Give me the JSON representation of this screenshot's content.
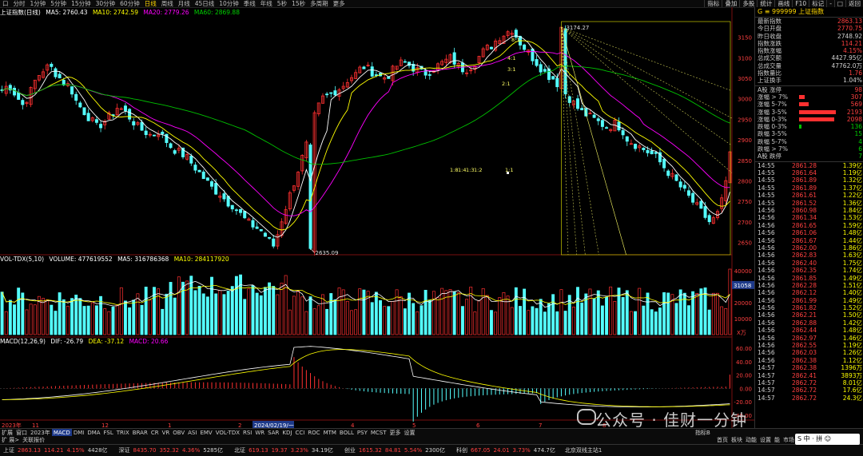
{
  "top_bar": {
    "left_items": [
      "口",
      "分时",
      "1分钟",
      "5分钟",
      "15分钟",
      "30分钟",
      "60分钟",
      "日线",
      "周线",
      "月线",
      "45日线",
      "10分钟",
      "季线",
      "年线",
      "5秒",
      "15秒",
      "多周期",
      "更多"
    ],
    "active": "日线",
    "right_items": [
      "指标",
      "叠加",
      "多股",
      "统计",
      "画线",
      "F10",
      "标记",
      "-",
      "□",
      "返回"
    ]
  },
  "price_legend": {
    "symbol": "上证指数(日线)",
    "ma5": "MA5: 2760.43",
    "ma10": "MA10: 2742.59",
    "ma20": "MA20: 2779.26",
    "ma60": "MA60: 2869.88"
  },
  "volume_legend": {
    "name": "VOL-TDX(5,10)",
    "volume": "VOLUME: 477619552",
    "ma5": "MA5: 316786368",
    "ma10": "MA10: 284117920"
  },
  "macd_legend": {
    "name": "MACD(12,26,9)",
    "dif": "DIF: -26.79",
    "dea": "DEA: -37.12",
    "macd": "MACD: 20.66"
  },
  "annotations": {
    "high": "3174.27",
    "low": "2635.09",
    "fan_labels": [
      "8:1",
      "4:1",
      "3:1",
      "2:1",
      "1:8",
      "1:4",
      "1:3",
      "1:2",
      "1:1"
    ],
    "date_cursor": "2024/02/19/一",
    "vol_value_box": "31058",
    "vol_unit": "X万"
  },
  "price_axis": [
    "3150",
    "3100",
    "3050",
    "3000",
    "2950",
    "2900",
    "2850",
    "2800",
    "2750",
    "2700",
    "2650"
  ],
  "volume_axis": [
    "40000",
    "30000",
    "20000",
    "10000"
  ],
  "macd_axis": [
    "60.00",
    "40.00",
    "20.00",
    "0.00",
    "-20.00",
    "-40.00"
  ],
  "x_labels": [
    "2023年",
    "11",
    "12",
    "1",
    "2",
    "3",
    "4",
    "5",
    "6",
    "7",
    "8"
  ],
  "side_panel": {
    "header": "G ≡ 999999 上证指数",
    "stats": [
      {
        "label": "最新指数",
        "value": "2863.13",
        "color": "#ff4040"
      },
      {
        "label": "今日开盘",
        "value": "2770.75",
        "color": "#ff4040"
      },
      {
        "label": "昨日收盘",
        "value": "2748.92",
        "color": "#d0d0d0"
      },
      {
        "label": "指数涨跌",
        "value": "114.21",
        "color": "#ff4040"
      },
      {
        "label": "指数涨幅",
        "value": "4.15%",
        "color": "#ff4040"
      },
      {
        "label": "总成交额",
        "value": "4427.95亿",
        "color": "#d0d0d0"
      },
      {
        "label": "总成交量",
        "value": "47762.0万",
        "color": "#d0d0d0"
      },
      {
        "label": "指数量比",
        "value": "1.76",
        "color": "#ff4040"
      },
      {
        "label": "上证换手",
        "value": "1.04%",
        "color": "#d0d0d0"
      }
    ],
    "breadth": [
      {
        "label": "A股 涨停",
        "value": "98",
        "color": "#ff4040",
        "bar": 0,
        "kind": "up"
      },
      {
        "label": "涨幅 > 7%",
        "value": "307",
        "color": "#ff4040",
        "bar": 7,
        "kind": "up"
      },
      {
        "label": "涨幅 5-7%",
        "value": "569",
        "color": "#ff4040",
        "bar": 12,
        "kind": "up"
      },
      {
        "label": "涨幅 3-5%",
        "value": "2193",
        "color": "#ff4040",
        "bar": 46,
        "kind": "up"
      },
      {
        "label": "涨幅 0-3%",
        "value": "2098",
        "color": "#ff4040",
        "bar": 44,
        "kind": "up"
      },
      {
        "label": "跌幅 0-3%",
        "value": "136",
        "color": "#00d000",
        "bar": 3,
        "kind": "down"
      },
      {
        "label": "跌幅 3-5%",
        "value": "15",
        "color": "#00d000",
        "bar": 0,
        "kind": "down"
      },
      {
        "label": "跌幅 5-7%",
        "value": "4",
        "color": "#00d000",
        "bar": 0,
        "kind": "down"
      },
      {
        "label": "跌幅 > 7%",
        "value": "6",
        "color": "#00d000",
        "bar": 0,
        "kind": "down"
      },
      {
        "label": "A股 跌停",
        "value": "7",
        "color": "#00d000",
        "bar": 0,
        "kind": "down"
      }
    ],
    "ticks": [
      {
        "time": "14:55",
        "price": "2861.28",
        "amount": "1.39亿"
      },
      {
        "time": "14:55",
        "price": "2861.64",
        "amount": "1.19亿"
      },
      {
        "time": "14:55",
        "price": "2861.89",
        "amount": "1.32亿"
      },
      {
        "time": "14:55",
        "price": "2861.89",
        "amount": "1.37亿"
      },
      {
        "time": "14:55",
        "price": "2861.61",
        "amount": "1.22亿"
      },
      {
        "time": "14:55",
        "price": "2861.52",
        "amount": "1.36亿"
      },
      {
        "time": "14:56",
        "price": "2860.98",
        "amount": "1.84亿"
      },
      {
        "time": "14:56",
        "price": "2861.34",
        "amount": "1.53亿"
      },
      {
        "time": "14:56",
        "price": "2861.65",
        "amount": "1.59亿"
      },
      {
        "time": "14:56",
        "price": "2861.06",
        "amount": "1.48亿"
      },
      {
        "time": "14:56",
        "price": "2861.67",
        "amount": "1.44亿"
      },
      {
        "time": "14:56",
        "price": "2862.00",
        "amount": "1.86亿"
      },
      {
        "time": "14:56",
        "price": "2862.83",
        "amount": "1.63亿"
      },
      {
        "time": "14:56",
        "price": "2862.40",
        "amount": "1.75亿"
      },
      {
        "time": "14:56",
        "price": "2862.35",
        "amount": "1.74亿"
      },
      {
        "time": "14:56",
        "price": "2861.85",
        "amount": "1.49亿"
      },
      {
        "time": "14:56",
        "price": "2862.28",
        "amount": "1.51亿"
      },
      {
        "time": "14:56",
        "price": "2862.12",
        "amount": "1.40亿"
      },
      {
        "time": "14:56",
        "price": "2861.99",
        "amount": "1.49亿"
      },
      {
        "time": "14:56",
        "price": "2861.82",
        "amount": "1.52亿"
      },
      {
        "time": "14:56",
        "price": "2862.21",
        "amount": "1.50亿"
      },
      {
        "time": "14:56",
        "price": "2862.88",
        "amount": "1.42亿"
      },
      {
        "time": "14:56",
        "price": "2862.44",
        "amount": "1.48亿"
      },
      {
        "time": "14:56",
        "price": "2862.97",
        "amount": "1.46亿"
      },
      {
        "time": "14:56",
        "price": "2862.55",
        "amount": "1.19亿"
      },
      {
        "time": "14:56",
        "price": "2862.03",
        "amount": "1.26亿"
      },
      {
        "time": "14:56",
        "price": "2862.38",
        "amount": "1.12亿"
      },
      {
        "time": "14:57",
        "price": "2862.38",
        "amount": "1396万"
      },
      {
        "time": "14:57",
        "price": "2862.41",
        "amount": "3893万"
      },
      {
        "time": "14:57",
        "price": "2862.72",
        "amount": "8.01亿"
      },
      {
        "time": "14:57",
        "price": "2862.72",
        "amount": "17.6亿"
      },
      {
        "time": "14:57",
        "price": "2862.72",
        "amount": "24.3亿"
      }
    ]
  },
  "indicator_tabs": [
    "2023年",
    "MACD",
    "DMI",
    "DMA",
    "FSL",
    "TRIX",
    "BRAR",
    "CR",
    "VR",
    "OBV",
    "ASI",
    "EMV",
    "VOL-TDX",
    "RSI",
    "WR",
    "SAR",
    "KDJ",
    "CCI",
    "ROC",
    "MTM",
    "BOLL",
    "PSY",
    "MCST",
    "更多",
    "设置"
  ],
  "indicator_active": "MACD",
  "tab_left": [
    "扩展",
    "窗口"
  ],
  "tab_right": "指标B",
  "second_row_left": [
    "扩 展>",
    "关联报价"
  ],
  "second_row_right": [
    "首页",
    "板块",
    "动能",
    "设置",
    "能",
    "市场"
  ],
  "status_bar": [
    {
      "label": "上证",
      "value": "2863.13",
      "chg": "114.21",
      "pct": "4.15%",
      "amt": "4428亿"
    },
    {
      "label": "深证",
      "value": "8435.70",
      "chg": "352.32",
      "pct": "4.36%",
      "amt": "5285亿"
    },
    {
      "label": "北证",
      "value": "619.13",
      "chg": "19.37",
      "pct": "3.23%",
      "amt": "34.19亿"
    },
    {
      "label": "创业",
      "value": "1615.32",
      "chg": "84.81",
      "pct": "5.54%",
      "amt": "2300亿"
    },
    {
      "label": "科创",
      "value": "667.05",
      "chg": "24.01",
      "pct": "3.73%",
      "amt": "474.7亿"
    }
  ],
  "status_right": "北京双线主站1",
  "watermark": "公众号 · 佳财一分钟",
  "ime": "S 中 · 拼 ☺",
  "colors": {
    "up": "#ff3030",
    "down": "#54ffff",
    "ma5": "#ffffff",
    "ma10": "#ffff00",
    "ma20": "#ff00ff",
    "ma60": "#00c000"
  },
  "chart_data": {
    "type": "candlestick",
    "title": "上证指数(日线)",
    "ylim": [
      2620,
      3190
    ],
    "key_points": [
      {
        "label": "2635.09",
        "kind": "low",
        "x_index": 75
      },
      {
        "label": "3174.27",
        "kind": "high",
        "x_index": 136
      }
    ],
    "close_path": [
      3020,
      3035,
      3010,
      2985,
      3010,
      3050,
      3070,
      3080,
      3060,
      3040,
      3030,
      2990,
      2970,
      2950,
      2930,
      2945,
      2960,
      2980,
      2970,
      2950,
      2930,
      2920,
      2910,
      2920,
      2900,
      2880,
      2870,
      2860,
      2840,
      2820,
      2800,
      2780,
      2770,
      2750,
      2740,
      2720,
      2700,
      2690,
      2680,
      2660,
      2640,
      2700,
      2750,
      2800,
      2850,
      2900,
      2960,
      3000,
      3010,
      3020,
      3030,
      3050,
      3060,
      3080,
      3070,
      3060,
      3050,
      3060,
      3080,
      3090,
      3080,
      3070,
      3060,
      3070,
      3080,
      3090,
      3100,
      3080,
      3070,
      3080,
      3100,
      3120,
      3130,
      3150,
      3160,
      3170,
      3140,
      3120,
      3100,
      3080,
      3060,
      3050,
      3030,
      3010,
      2990,
      2970,
      2960,
      2950,
      2940,
      2930,
      2940,
      2930,
      2900,
      2890,
      2880,
      2870,
      2860,
      2840,
      2820,
      2800,
      2780,
      2760,
      2740,
      2720,
      2700,
      2710,
      2760,
      2860
    ],
    "volume_axis_range": [
      0,
      45000
    ],
    "macd_axis_range": [
      -45,
      65
    ]
  }
}
